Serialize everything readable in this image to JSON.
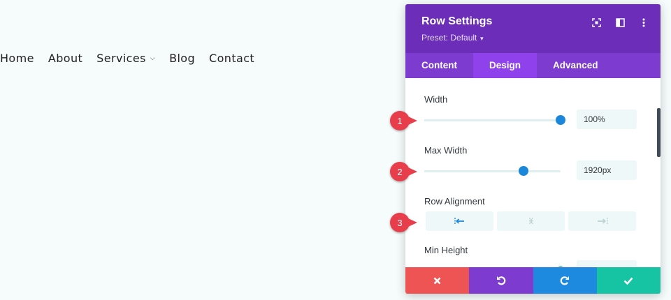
{
  "nav": {
    "items": [
      {
        "label": "Home"
      },
      {
        "label": "About"
      },
      {
        "label": "Services",
        "has_dropdown": true
      },
      {
        "label": "Blog"
      },
      {
        "label": "Contact"
      }
    ]
  },
  "panel": {
    "title": "Row Settings",
    "preset": "Preset: Default",
    "header_icons": [
      "fullscreen-icon",
      "split-view-icon",
      "more-vertical-icon"
    ],
    "tabs": [
      {
        "label": "Content"
      },
      {
        "label": "Design",
        "active": true
      },
      {
        "label": "Advanced"
      }
    ],
    "settings": {
      "width": {
        "label": "Width",
        "value": "100%",
        "slider_fraction": 1.0
      },
      "max_width": {
        "label": "Max Width",
        "value": "1920px",
        "slider_fraction": 0.73
      },
      "row_alignment": {
        "label": "Row Alignment",
        "options": [
          "align-left-icon",
          "align-center-icon",
          "align-right-icon"
        ],
        "selected": "align-left-icon"
      },
      "min_height": {
        "label": "Min Height",
        "slider_fraction": 1.0
      }
    },
    "footer": [
      "close-icon",
      "undo-icon",
      "redo-icon",
      "check-icon"
    ]
  },
  "callouts": [
    "1",
    "2",
    "3"
  ],
  "colors": {
    "header": "#6c2eb9",
    "tabs": "#7e3bd0",
    "tab_active": "#8f42ec",
    "slider_accent": "#1a87da",
    "close": "#ef5454",
    "undo": "#7e3bd0",
    "redo": "#1d8ae0",
    "save": "#16c3a3",
    "callout": "#e83e4b"
  }
}
